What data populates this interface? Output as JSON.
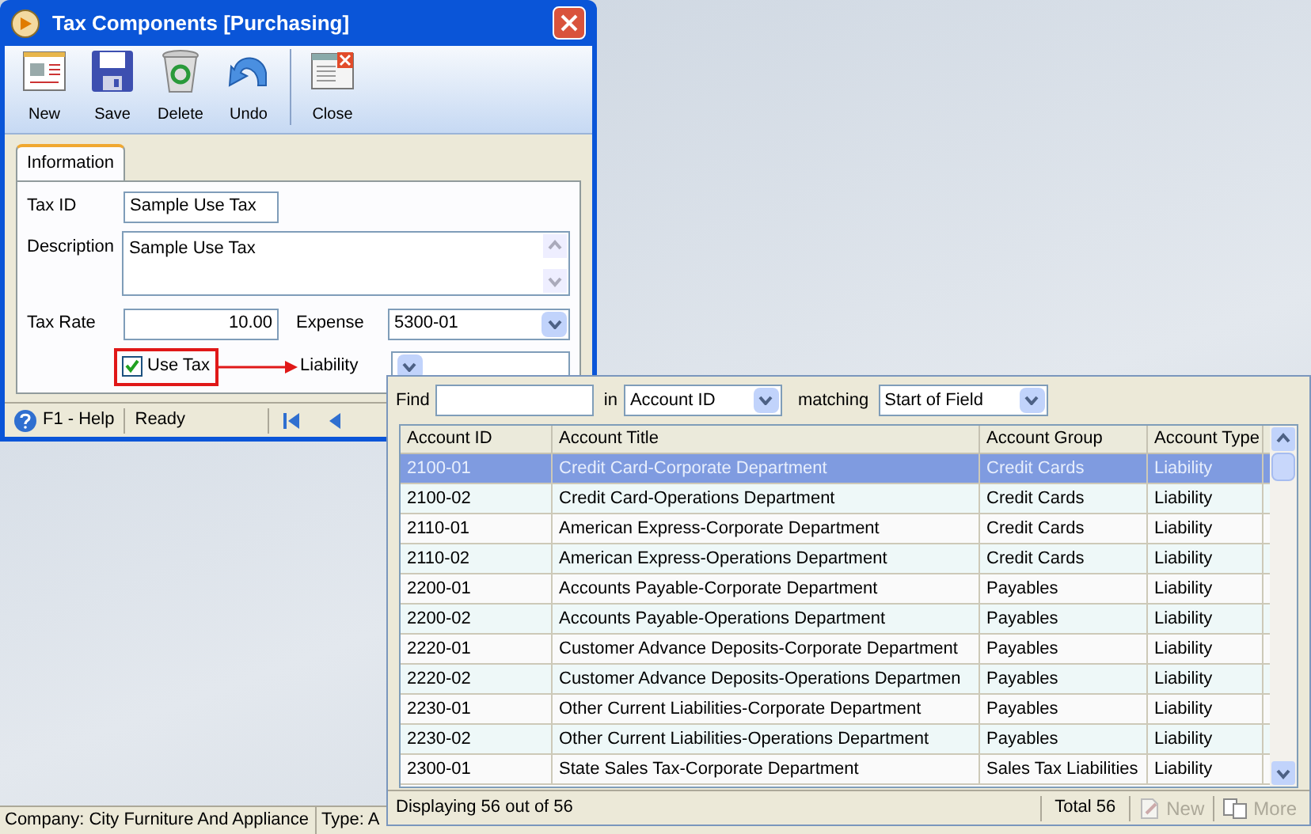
{
  "window": {
    "title": "Tax Components [Purchasing]",
    "toolbar": [
      "New",
      "Save",
      "Delete",
      "Undo",
      "Close"
    ],
    "tabs": [
      {
        "label": "Information",
        "selected": true
      }
    ],
    "form": {
      "tax_id": {
        "label": "Tax ID",
        "value": "Sample Use Tax"
      },
      "description": {
        "label": "Description",
        "value": "Sample Use Tax"
      },
      "tax_rate": {
        "label": "Tax Rate",
        "value": "10.00"
      },
      "expense": {
        "label": "Expense",
        "value": "5300-01"
      },
      "use_tax": {
        "label": "Use Tax",
        "checked": true
      },
      "liability": {
        "label": "Liability"
      }
    },
    "status_bar": {
      "help": "F1 - Help",
      "state": "Ready"
    }
  },
  "lookup": {
    "find_label": "Find",
    "in_label": "in",
    "in_value": "Account ID",
    "matching_label": "matching",
    "matching_value": "Start of Field",
    "columns": [
      "Account ID",
      "Account Title",
      "Account Group",
      "Account Type"
    ],
    "rows": [
      {
        "cells": [
          "2100-01",
          "Credit Card-Corporate Department",
          "Credit Cards",
          "Liability"
        ],
        "selected": true
      },
      {
        "cells": [
          "2100-02",
          "Credit Card-Operations Department",
          "Credit Cards",
          "Liability"
        ],
        "selected": false
      },
      {
        "cells": [
          "2110-01",
          "American Express-Corporate Department",
          "Credit Cards",
          "Liability"
        ],
        "selected": false
      },
      {
        "cells": [
          "2110-02",
          "American Express-Operations Department",
          "Credit Cards",
          "Liability"
        ],
        "selected": false
      },
      {
        "cells": [
          "2200-01",
          "Accounts Payable-Corporate Department",
          "Payables",
          "Liability"
        ],
        "selected": false
      },
      {
        "cells": [
          "2200-02",
          "Accounts Payable-Operations Department",
          "Payables",
          "Liability"
        ],
        "selected": false
      },
      {
        "cells": [
          "2220-01",
          "Customer Advance Deposits-Corporate Department",
          "Payables",
          "Liability"
        ],
        "selected": false
      },
      {
        "cells": [
          "2220-02",
          "Customer Advance Deposits-Operations Departmen",
          "Payables",
          "Liability"
        ],
        "selected": false
      },
      {
        "cells": [
          "2230-01",
          "Other Current Liabilities-Corporate Department",
          "Payables",
          "Liability"
        ],
        "selected": false
      },
      {
        "cells": [
          "2230-02",
          "Other Current Liabilities-Operations Department",
          "Payables",
          "Liability"
        ],
        "selected": false
      },
      {
        "cells": [
          "2300-01",
          "State Sales Tax-Corporate Department",
          "Sales Tax Liabilities",
          "Liability"
        ],
        "selected": false
      }
    ],
    "footer": {
      "displaying": "Displaying 56 out of 56",
      "total": "Total 56",
      "buttons": [
        {
          "label": "New",
          "disabled": true
        },
        {
          "label": "More",
          "disabled": true
        }
      ]
    }
  },
  "status_bar": [
    "Company: City Furniture And Appliance",
    "Type: A"
  ]
}
